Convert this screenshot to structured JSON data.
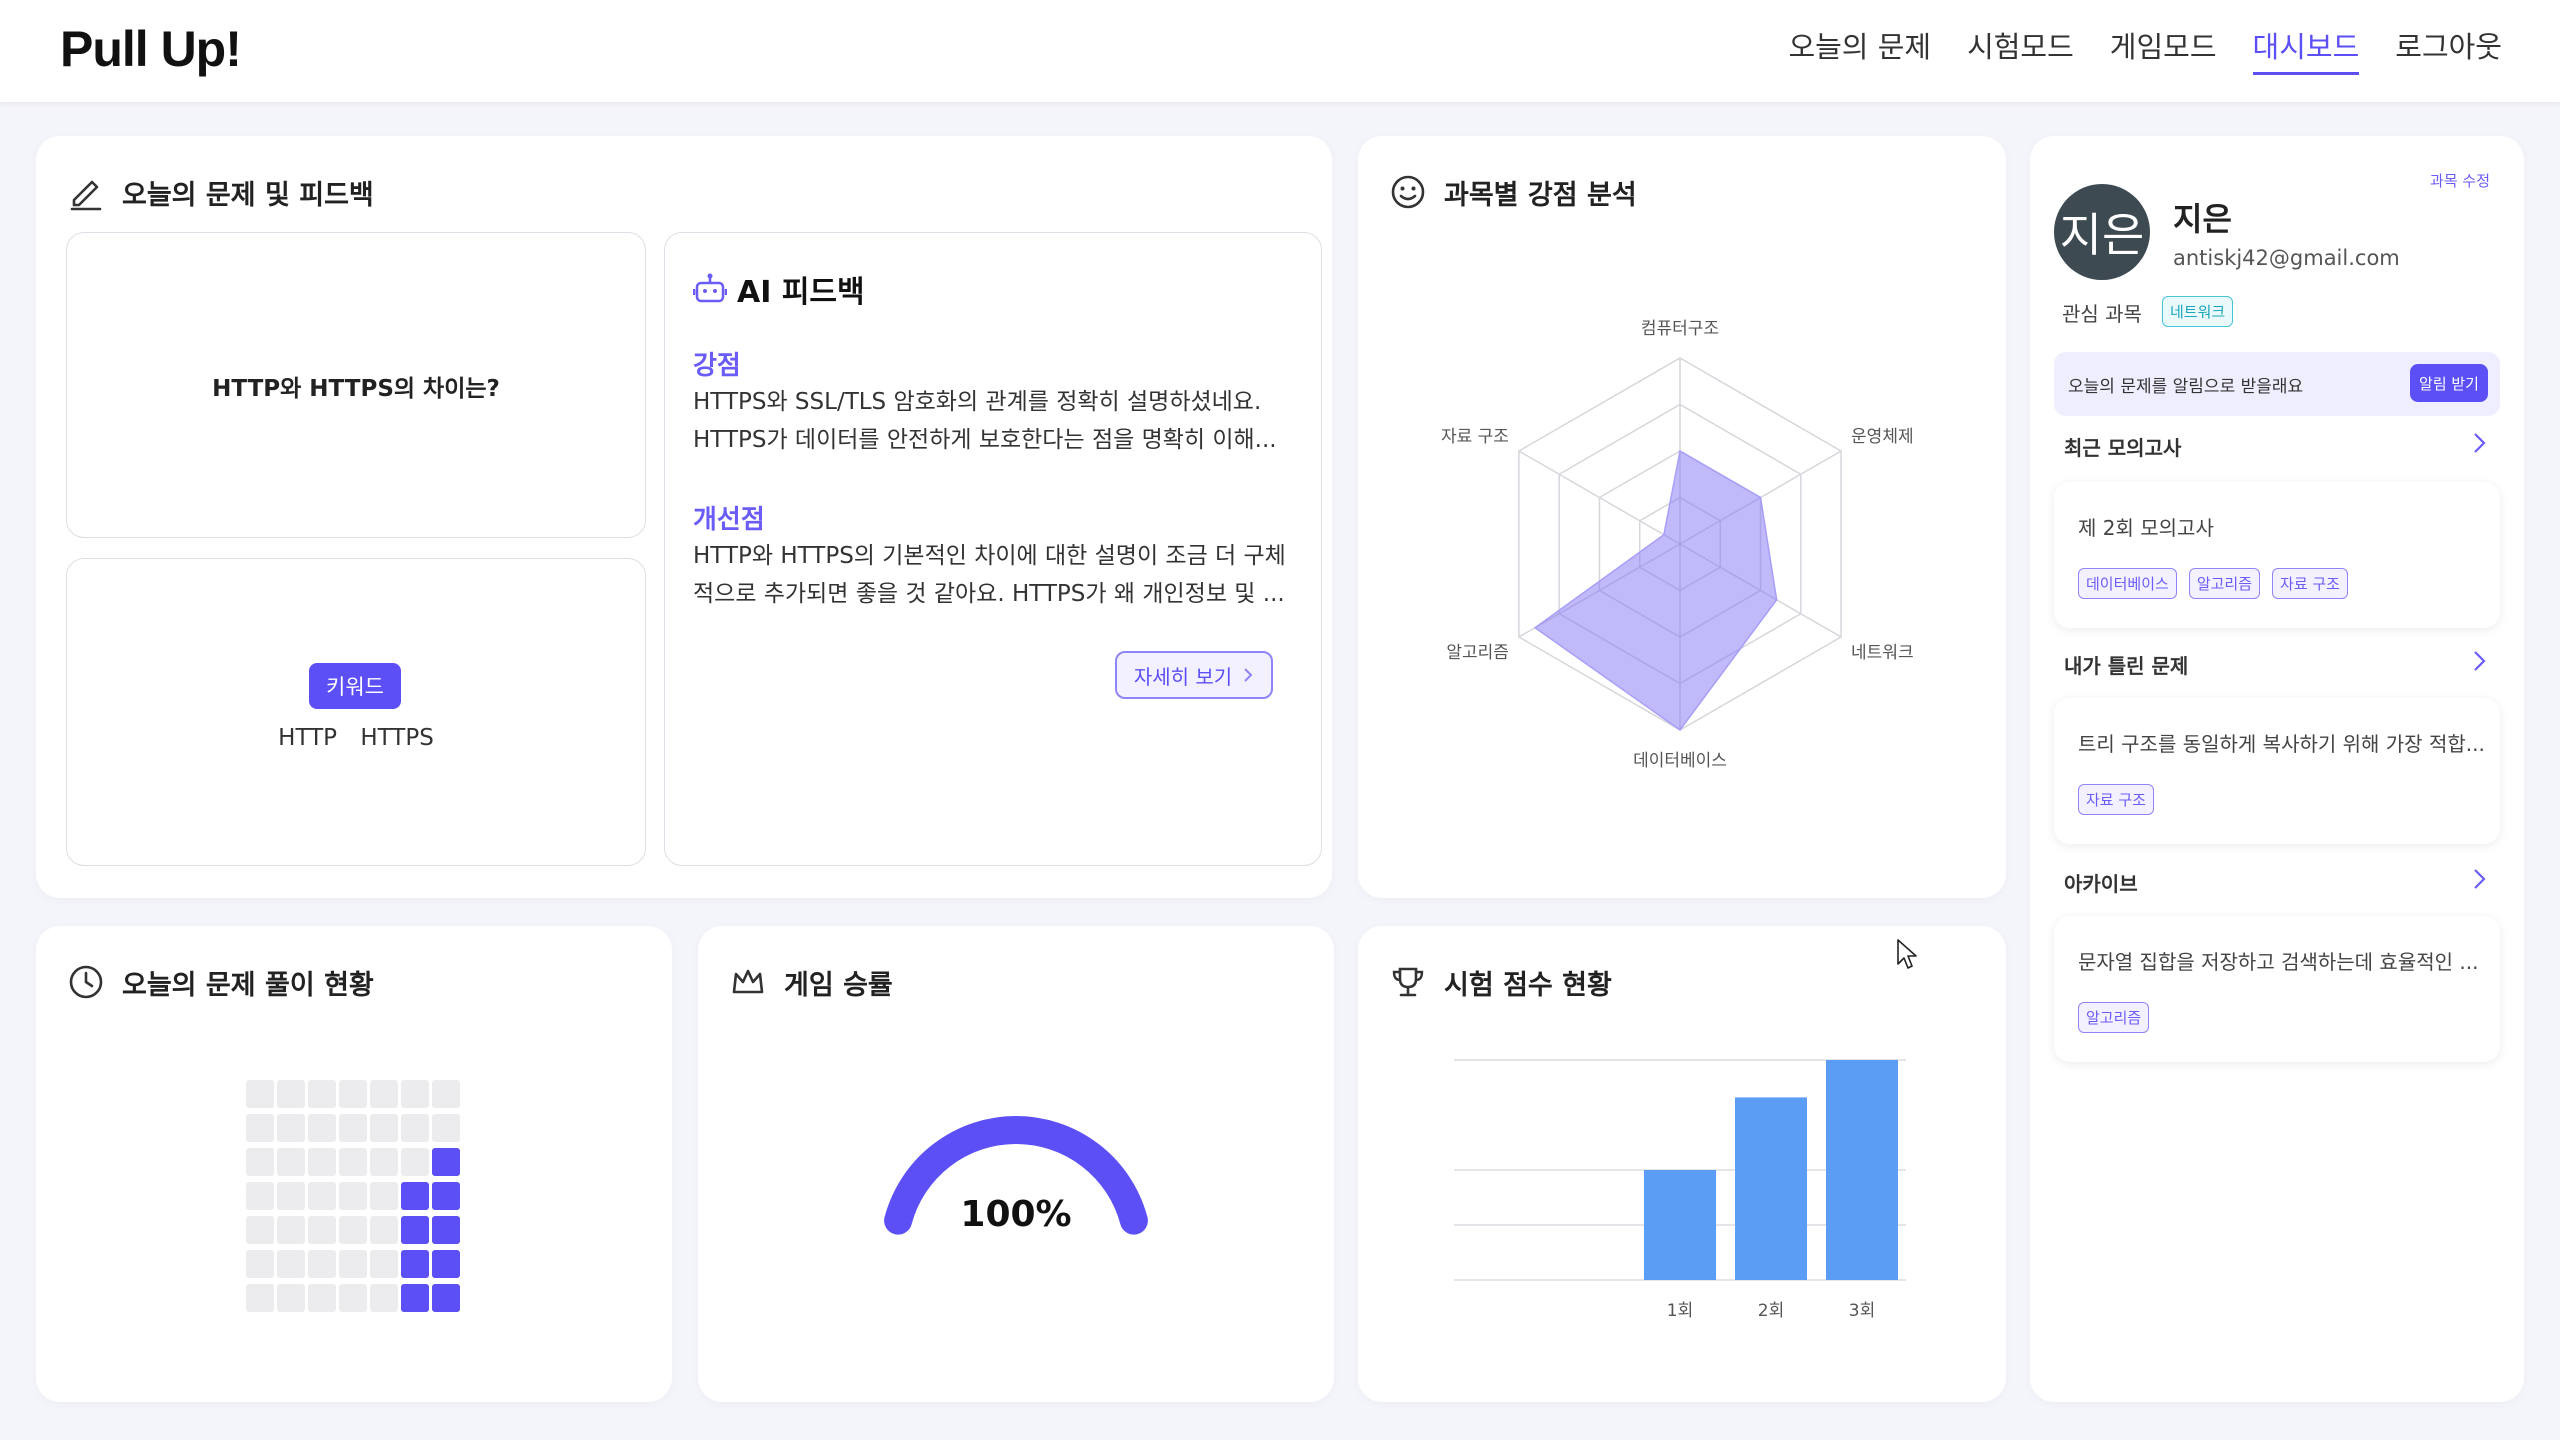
{
  "header": {
    "logo": "Pull Up!",
    "nav": [
      "오늘의 문제",
      "시험모드",
      "게임모드",
      "대시보드",
      "로그아웃"
    ],
    "active_nav": "대시보드"
  },
  "today_card": {
    "title": "오늘의 문제 및 피드백",
    "question": "HTTP와 HTTPS의 차이는?",
    "keyword_badge": "키워드",
    "keywords": [
      "HTTP",
      "HTTPS"
    ],
    "ai": {
      "title": "AI 피드백",
      "strength_heading": "강점",
      "strength_lines": [
        "HTTPS와 SSL/TLS 암호화의 관계를 정확히 설명하셨네요.",
        "HTTPS가 데이터를 안전하게 보호한다는 점을 명확히 이해..."
      ],
      "improve_heading": "개선점",
      "improve_lines": [
        "HTTP와 HTTPS의 기본적인 차이에 대한 설명이 조금 더 구체",
        "적으로 추가되면 좋을 것 같아요. HTTPS가 왜 개인정보 및 ..."
      ],
      "more_button": "자세히 보기"
    }
  },
  "radar_card": {
    "title": "과목별 강점 분석",
    "chart_data": {
      "type": "radar",
      "axes": [
        "컴퓨터구조",
        "운영체제",
        "네트워크",
        "데이터베이스",
        "알고리즘",
        "자료 구조"
      ],
      "values": [
        0.5,
        0.5,
        0.6,
        1.0,
        0.9,
        0.1
      ],
      "max": 1.0
    }
  },
  "profile": {
    "avatar_text": "지은",
    "name": "지은",
    "email": "antiskj42@gmail.com",
    "edit_link": "과목 수정",
    "interest_label": "관심 과목",
    "interest_tag": "네트워크",
    "notify_text": "오늘의 문제를 알림으로 받을래요",
    "notify_button": "알림 받기",
    "sections": [
      {
        "label": "최근 모의고사",
        "text": "제 2회 모의고사",
        "tags": [
          "데이터베이스",
          "알고리즘",
          "자료 구조"
        ]
      },
      {
        "label": "내가 틀린 문제",
        "text": "트리 구조를 동일하게 복사하기 위해 가장 적합...",
        "tags": [
          "자료 구조"
        ]
      },
      {
        "label": "아카이브",
        "text": "문자열 집합을 저장하고 검색하는데 효율적인 ...",
        "tags": [
          "알고리즘"
        ]
      }
    ]
  },
  "progress_card": {
    "title": "오늘의 문제 풀이 현황",
    "grid_rows": 7,
    "grid_cols": 7,
    "filled": [
      [
        2,
        6
      ],
      [
        3,
        5
      ],
      [
        3,
        6
      ],
      [
        4,
        5
      ],
      [
        4,
        6
      ],
      [
        5,
        5
      ],
      [
        5,
        6
      ],
      [
        6,
        5
      ],
      [
        6,
        6
      ]
    ],
    "colors": {
      "filled": "#5b4ff5",
      "empty": "#ececef"
    }
  },
  "game_card": {
    "title": "게임 승률",
    "win_rate_label": "100%",
    "win_rate": 1.0,
    "color": "#5b4ff5"
  },
  "exam_card": {
    "title": "시험 점수 현황",
    "chart_data": {
      "type": "bar",
      "categories": [
        "1회",
        "2회",
        "3회"
      ],
      "values": [
        50,
        83,
        100
      ],
      "ylim": [
        0,
        100
      ],
      "color": "#5b9cf5"
    }
  }
}
